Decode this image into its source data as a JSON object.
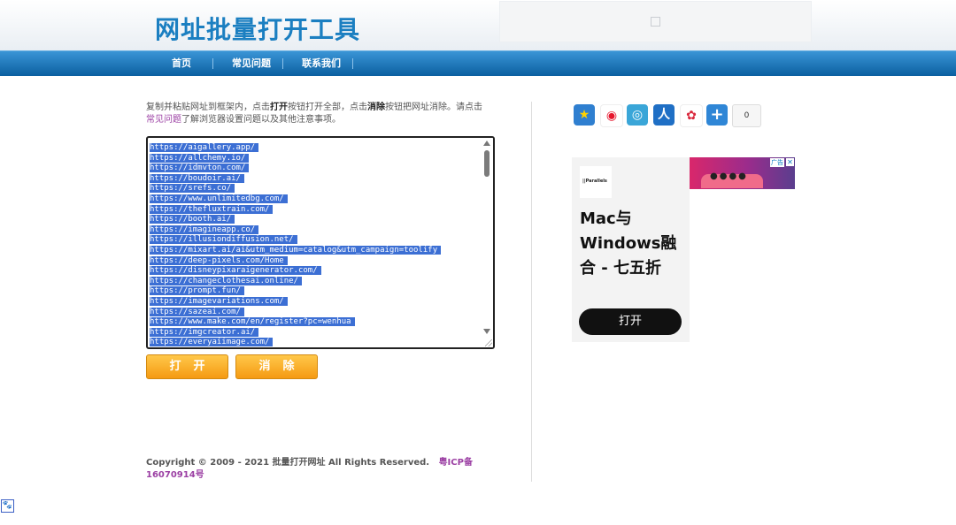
{
  "header": {
    "title": "网址批量打开工具"
  },
  "nav": {
    "items": [
      "首页",
      "常见问题",
      "联系我们"
    ]
  },
  "intro": {
    "part1": "复制并粘贴网址到框架内，点击",
    "open_word": "打开",
    "part2": "按钮打开全部，点击",
    "clear_word": "消除",
    "part3": "按钮把网址消除。请点击",
    "faq_link": "常见问题",
    "part4": "了解浏览器设置问题以及其他注意事项。"
  },
  "urls": [
    "https://aigallery.app/",
    "https://allchemy.io/",
    "https://idmvton.com/",
    "https://boudoir.ai/",
    "https://srefs.co/",
    "https://www.unlimitedbg.com/",
    "https://thefluxtrain.com/",
    "https://booth.ai/",
    "https://imagineapp.co/",
    "https://illusiondiffusion.net/",
    "https://mixart.ai/ai&utm_medium=catalog&utm_campaign=toolify",
    "https://deep-pixels.com/Home",
    "https://disneypixaraigenerator.com/",
    "https://changeclothesai.online/",
    "https://prompt.fun/",
    "https://imagevariations.com/",
    "https://sazeai.com/",
    "https://www.make.com/en/register?pc=wenhua",
    "https://imgcreator.ai/",
    "https://everyaiimage.com/"
  ],
  "buttons": {
    "open": "打开",
    "clear": "消除"
  },
  "footer": {
    "copyright": "Copyright © 2009 - 2021 批量打开网址 All Rights Reserved.",
    "icp": "粤ICP备16070914号"
  },
  "share": {
    "count": "0",
    "icons": [
      "qzone-icon",
      "weibo-icon",
      "tencent-weibo-icon",
      "renren-icon",
      "kaixin-icon",
      "more-share-icon"
    ]
  },
  "ad": {
    "brand": "Parallels",
    "headline": "Mac与Windows融合 - 七五折",
    "button": "打开",
    "choice_label": "广告",
    "close": "✕"
  },
  "colors": {
    "accent": "#1b7fc1",
    "nav": "#0b5fa0",
    "button": "#f59a12",
    "link": "#9b3fa3"
  }
}
